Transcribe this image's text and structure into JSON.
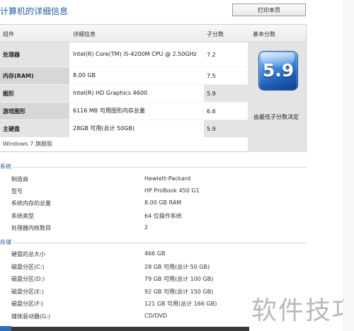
{
  "header": {
    "title": "计算机的详细信息",
    "print_label": "打印本页"
  },
  "score_table": {
    "columns": {
      "component": "组件",
      "details": "详细信息",
      "subscore": "子分数",
      "base": "基本分数"
    },
    "rows": [
      {
        "component": "处理器",
        "details": "Intel(R) Core(TM) i5-4200M CPU @ 2.50GHz",
        "score": "7.2"
      },
      {
        "component": "内存(RAM)",
        "details": "8.00 GB",
        "score": "7.5"
      },
      {
        "component": "图形",
        "details": "Intel(R) HD Graphics 4600",
        "score": "5.9"
      },
      {
        "component": "游戏图形",
        "details": "6116 MB 可用图形内存总量",
        "score": "6.6"
      },
      {
        "component": "主硬盘",
        "details": "28GB 可用(总计 50GB)",
        "score": "5.9"
      }
    ],
    "base_score": "5.9",
    "base_caption": "由最低子分数决定",
    "os": "Windows 7 旗舰版"
  },
  "system": {
    "label": "系统",
    "rows": [
      {
        "key": "制造商",
        "value": "Hewlett-Packard"
      },
      {
        "key": "型号",
        "value": "HP ProBook 450 G1"
      },
      {
        "key": "系统内存的总量",
        "value": "8.00 GB RAM"
      },
      {
        "key": "系统类型",
        "value": "64 位操作系统"
      },
      {
        "key": "处理器内核数目",
        "value": "2"
      }
    ]
  },
  "storage": {
    "label": "存储",
    "rows": [
      {
        "key": "硬盘的总大小",
        "value": "466 GB"
      },
      {
        "key": "磁盘分区(C:)",
        "value": "28 GB 可用(总计 50 GB)"
      },
      {
        "key": "磁盘分区(D:)",
        "value": "79 GB 可用(总计 100 GB)"
      },
      {
        "key": "磁盘分区(E:)",
        "value": "92 GB 可用(总计 150 GB)"
      },
      {
        "key": "磁盘分区(F:)",
        "value": "121 GB 可用(总计 166 GB)"
      },
      {
        "key": "媒体驱动器(G:)",
        "value": "CD/DVD"
      }
    ]
  },
  "watermark": "软件技巧",
  "colors": {
    "accent": "#1f5a9d",
    "shaded_cell": "#e4e4e4",
    "score_badge": "#2c73cc"
  },
  "icons": {
    "base_score_badge": "wei-score-badge-icon"
  }
}
